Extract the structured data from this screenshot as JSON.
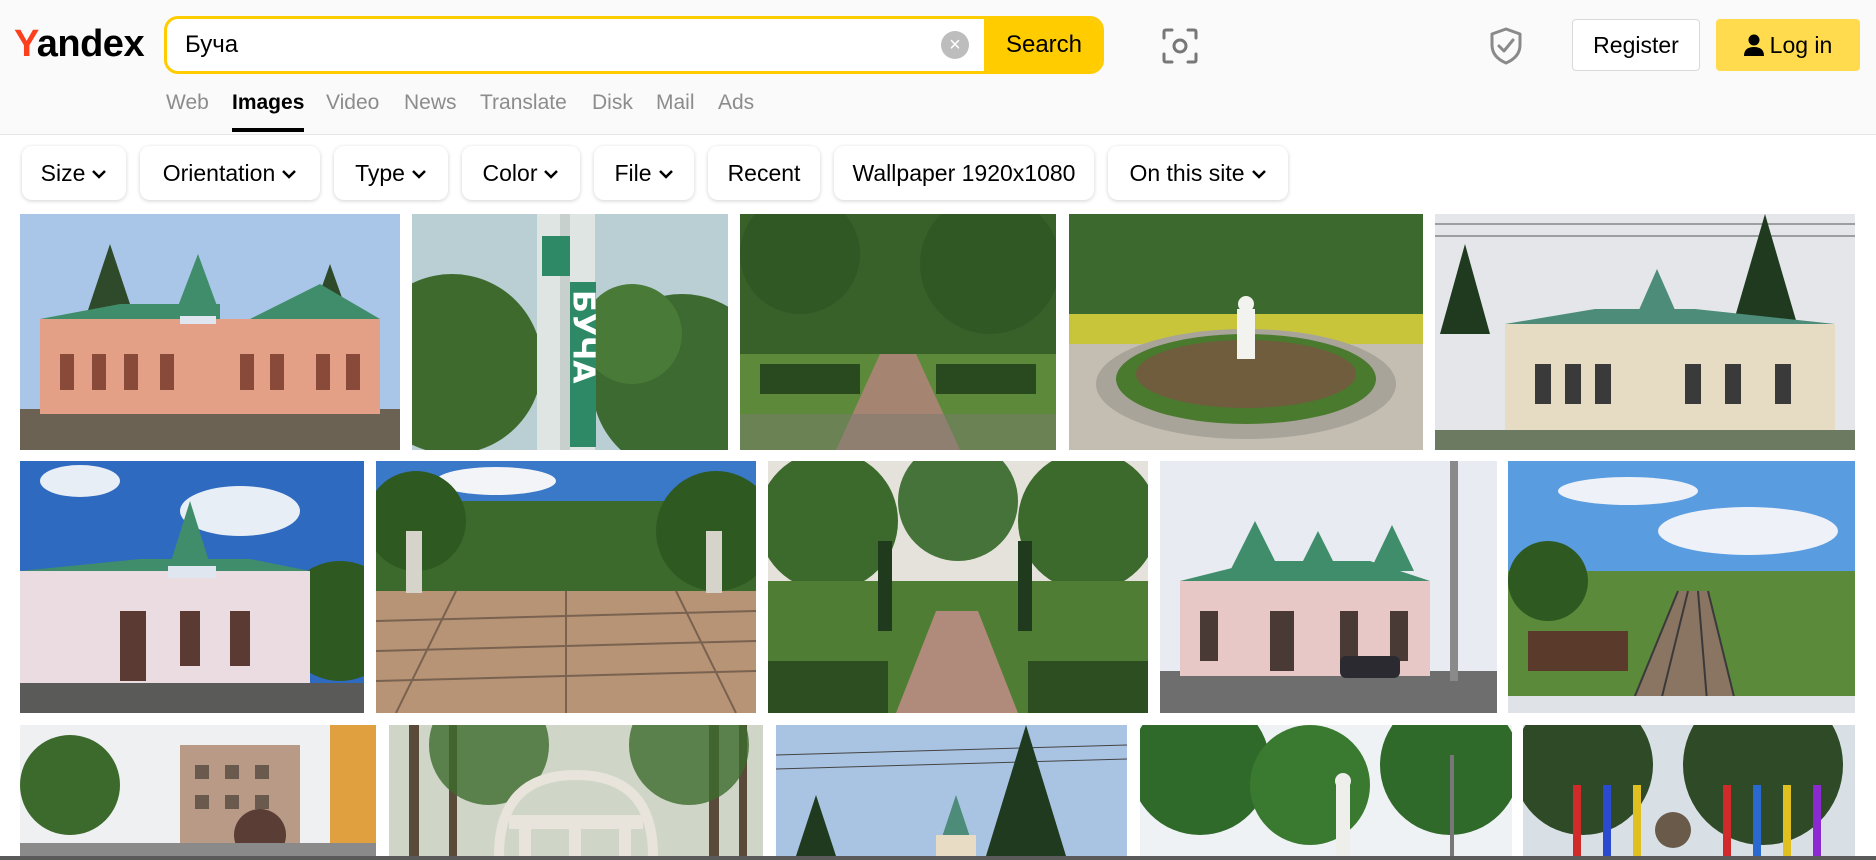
{
  "logo": {
    "first": "Y",
    "rest": "andex"
  },
  "search": {
    "query": "Буча",
    "clear_symbol": "×",
    "button_label": "Search"
  },
  "header": {
    "register_label": "Register",
    "login_label": "Log in"
  },
  "nav": {
    "tabs": [
      {
        "label": "Web",
        "active": false
      },
      {
        "label": "Images",
        "active": true
      },
      {
        "label": "Video",
        "active": false
      },
      {
        "label": "News",
        "active": false
      },
      {
        "label": "Translate",
        "active": false
      },
      {
        "label": "Disk",
        "active": false
      },
      {
        "label": "Mail",
        "active": false
      },
      {
        "label": "Ads",
        "active": false
      }
    ]
  },
  "filters": [
    {
      "label": "Size",
      "dropdown": true
    },
    {
      "label": "Orientation",
      "dropdown": true
    },
    {
      "label": "Type",
      "dropdown": true
    },
    {
      "label": "Color",
      "dropdown": true
    },
    {
      "label": "File",
      "dropdown": true
    },
    {
      "label": "Recent",
      "dropdown": false
    },
    {
      "label": "Wallpaper 1920x1080",
      "dropdown": false
    },
    {
      "label": "On this site",
      "dropdown": true
    }
  ],
  "colors": {
    "accent": "#ffcc00",
    "login_bg": "#ffdb4d",
    "logo_red": "#fc3f1d",
    "inactive_tab": "#8c8c8c"
  },
  "results": [
    {
      "subject": "station-building"
    },
    {
      "subject": "city-sign",
      "sign_text": "БУЧА"
    },
    {
      "subject": "garden-path"
    },
    {
      "subject": "park-statue"
    },
    {
      "subject": "station-building"
    },
    {
      "subject": "station-building"
    },
    {
      "subject": "paved-square"
    },
    {
      "subject": "garden-path"
    },
    {
      "subject": "station-building"
    },
    {
      "subject": "railway"
    },
    {
      "subject": "street"
    },
    {
      "subject": "gazebo"
    },
    {
      "subject": "church-spire"
    },
    {
      "subject": "park-statue"
    },
    {
      "subject": "flags"
    }
  ]
}
